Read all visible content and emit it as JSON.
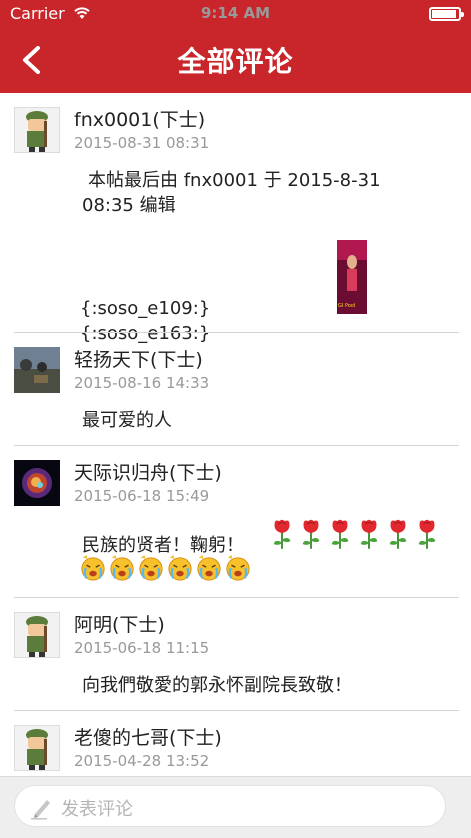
{
  "status_bar": {
    "carrier": "Carrier",
    "time": "9:14 AM"
  },
  "nav": {
    "title": "全部评论"
  },
  "comments": [
    {
      "name": "fnx0001(下士)",
      "time": "2015-08-31 08:31",
      "content": "本帖最后由 fnx0001 于 2015-8-31 08:35 编辑",
      "content2": "{:soso_e109:}{:soso_e163:}",
      "image_caption": "GI Pool"
    },
    {
      "name": "轻扬天下(下士)",
      "time": "2015-08-16 14:33",
      "content": "最可爱的人"
    },
    {
      "name": "天际识归舟(下士)",
      "time": "2015-06-18 15:49",
      "content": "民族的贤者！鞠躬！",
      "emoji": {
        "rose_count": 6,
        "sad_count": 6
      }
    },
    {
      "name": "阿明(下士)",
      "time": "2015-06-18 11:15",
      "content": "向我們敬愛的郭永怀副院長致敬！"
    },
    {
      "name": "老傻的七哥(下士)",
      "time": "2015-04-28 13:52"
    }
  ],
  "input": {
    "placeholder": "发表评论"
  },
  "colors": {
    "brand": "#c8262a",
    "time_gray": "#999999",
    "divider": "#d5d5d5"
  }
}
